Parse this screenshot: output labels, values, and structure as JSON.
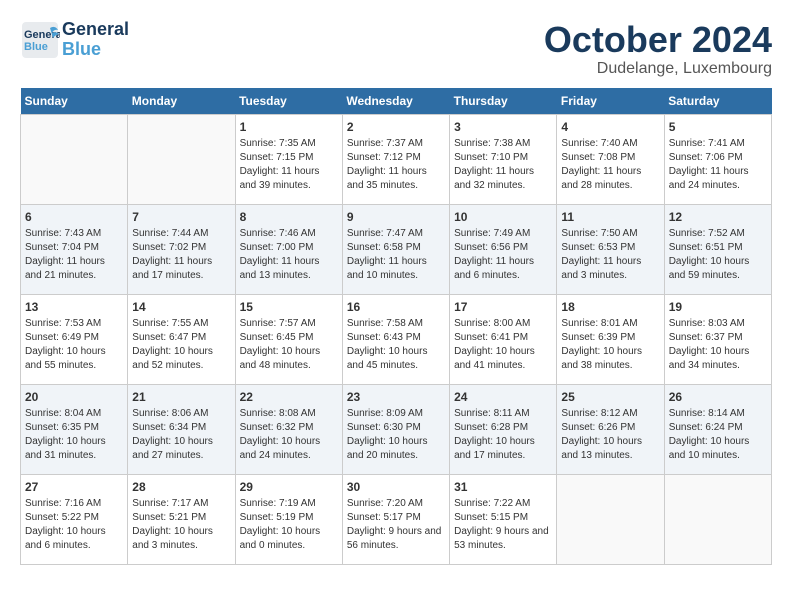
{
  "header": {
    "logo_general": "General",
    "logo_blue": "Blue",
    "month_title": "October 2024",
    "location": "Dudelange, Luxembourg"
  },
  "days_of_week": [
    "Sunday",
    "Monday",
    "Tuesday",
    "Wednesday",
    "Thursday",
    "Friday",
    "Saturday"
  ],
  "weeks": [
    [
      {
        "day": "",
        "info": ""
      },
      {
        "day": "",
        "info": ""
      },
      {
        "day": "1",
        "info": "Sunrise: 7:35 AM\nSunset: 7:15 PM\nDaylight: 11 hours and 39 minutes."
      },
      {
        "day": "2",
        "info": "Sunrise: 7:37 AM\nSunset: 7:12 PM\nDaylight: 11 hours and 35 minutes."
      },
      {
        "day": "3",
        "info": "Sunrise: 7:38 AM\nSunset: 7:10 PM\nDaylight: 11 hours and 32 minutes."
      },
      {
        "day": "4",
        "info": "Sunrise: 7:40 AM\nSunset: 7:08 PM\nDaylight: 11 hours and 28 minutes."
      },
      {
        "day": "5",
        "info": "Sunrise: 7:41 AM\nSunset: 7:06 PM\nDaylight: 11 hours and 24 minutes."
      }
    ],
    [
      {
        "day": "6",
        "info": "Sunrise: 7:43 AM\nSunset: 7:04 PM\nDaylight: 11 hours and 21 minutes."
      },
      {
        "day": "7",
        "info": "Sunrise: 7:44 AM\nSunset: 7:02 PM\nDaylight: 11 hours and 17 minutes."
      },
      {
        "day": "8",
        "info": "Sunrise: 7:46 AM\nSunset: 7:00 PM\nDaylight: 11 hours and 13 minutes."
      },
      {
        "day": "9",
        "info": "Sunrise: 7:47 AM\nSunset: 6:58 PM\nDaylight: 11 hours and 10 minutes."
      },
      {
        "day": "10",
        "info": "Sunrise: 7:49 AM\nSunset: 6:56 PM\nDaylight: 11 hours and 6 minutes."
      },
      {
        "day": "11",
        "info": "Sunrise: 7:50 AM\nSunset: 6:53 PM\nDaylight: 11 hours and 3 minutes."
      },
      {
        "day": "12",
        "info": "Sunrise: 7:52 AM\nSunset: 6:51 PM\nDaylight: 10 hours and 59 minutes."
      }
    ],
    [
      {
        "day": "13",
        "info": "Sunrise: 7:53 AM\nSunset: 6:49 PM\nDaylight: 10 hours and 55 minutes."
      },
      {
        "day": "14",
        "info": "Sunrise: 7:55 AM\nSunset: 6:47 PM\nDaylight: 10 hours and 52 minutes."
      },
      {
        "day": "15",
        "info": "Sunrise: 7:57 AM\nSunset: 6:45 PM\nDaylight: 10 hours and 48 minutes."
      },
      {
        "day": "16",
        "info": "Sunrise: 7:58 AM\nSunset: 6:43 PM\nDaylight: 10 hours and 45 minutes."
      },
      {
        "day": "17",
        "info": "Sunrise: 8:00 AM\nSunset: 6:41 PM\nDaylight: 10 hours and 41 minutes."
      },
      {
        "day": "18",
        "info": "Sunrise: 8:01 AM\nSunset: 6:39 PM\nDaylight: 10 hours and 38 minutes."
      },
      {
        "day": "19",
        "info": "Sunrise: 8:03 AM\nSunset: 6:37 PM\nDaylight: 10 hours and 34 minutes."
      }
    ],
    [
      {
        "day": "20",
        "info": "Sunrise: 8:04 AM\nSunset: 6:35 PM\nDaylight: 10 hours and 31 minutes."
      },
      {
        "day": "21",
        "info": "Sunrise: 8:06 AM\nSunset: 6:34 PM\nDaylight: 10 hours and 27 minutes."
      },
      {
        "day": "22",
        "info": "Sunrise: 8:08 AM\nSunset: 6:32 PM\nDaylight: 10 hours and 24 minutes."
      },
      {
        "day": "23",
        "info": "Sunrise: 8:09 AM\nSunset: 6:30 PM\nDaylight: 10 hours and 20 minutes."
      },
      {
        "day": "24",
        "info": "Sunrise: 8:11 AM\nSunset: 6:28 PM\nDaylight: 10 hours and 17 minutes."
      },
      {
        "day": "25",
        "info": "Sunrise: 8:12 AM\nSunset: 6:26 PM\nDaylight: 10 hours and 13 minutes."
      },
      {
        "day": "26",
        "info": "Sunrise: 8:14 AM\nSunset: 6:24 PM\nDaylight: 10 hours and 10 minutes."
      }
    ],
    [
      {
        "day": "27",
        "info": "Sunrise: 7:16 AM\nSunset: 5:22 PM\nDaylight: 10 hours and 6 minutes."
      },
      {
        "day": "28",
        "info": "Sunrise: 7:17 AM\nSunset: 5:21 PM\nDaylight: 10 hours and 3 minutes."
      },
      {
        "day": "29",
        "info": "Sunrise: 7:19 AM\nSunset: 5:19 PM\nDaylight: 10 hours and 0 minutes."
      },
      {
        "day": "30",
        "info": "Sunrise: 7:20 AM\nSunset: 5:17 PM\nDaylight: 9 hours and 56 minutes."
      },
      {
        "day": "31",
        "info": "Sunrise: 7:22 AM\nSunset: 5:15 PM\nDaylight: 9 hours and 53 minutes."
      },
      {
        "day": "",
        "info": ""
      },
      {
        "day": "",
        "info": ""
      }
    ]
  ]
}
